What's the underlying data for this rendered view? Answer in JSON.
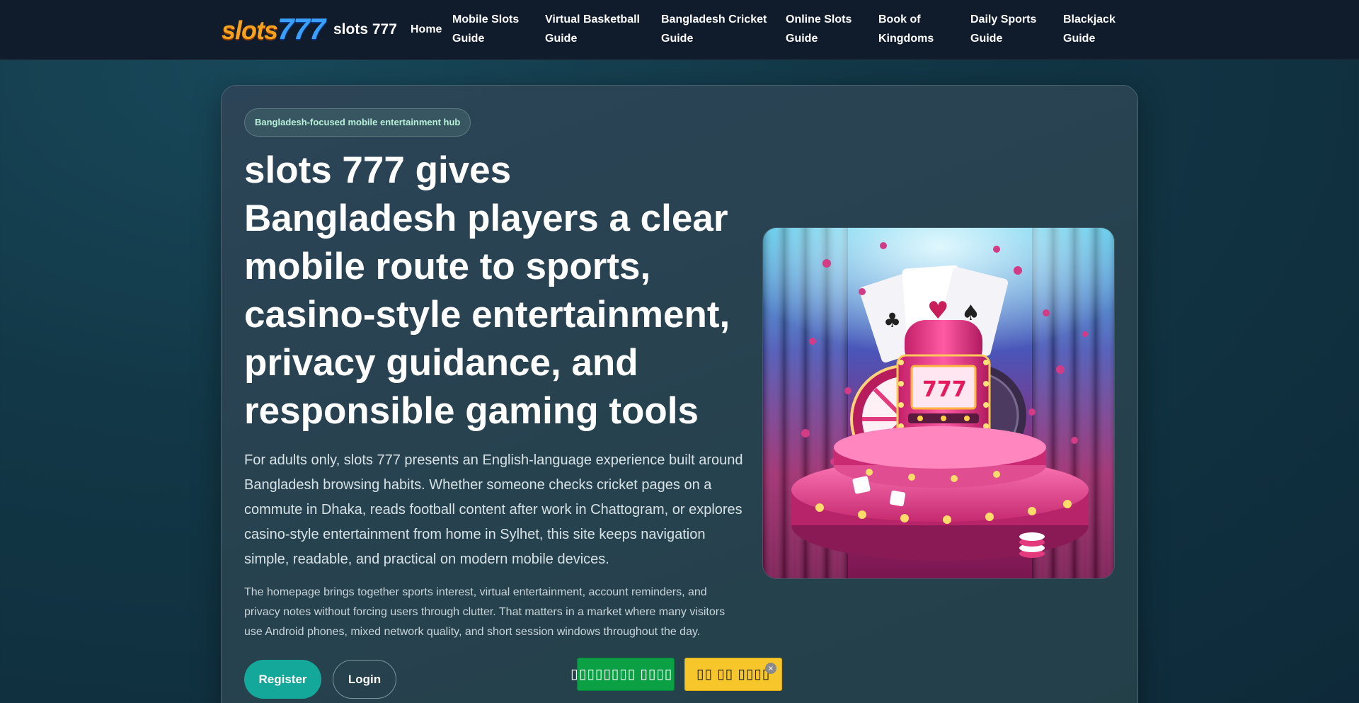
{
  "header": {
    "logo_part1": "slots",
    "logo_part2": "777",
    "brand_name": "slots 777",
    "nav": [
      {
        "line1": "Home",
        "line2": ""
      },
      {
        "line1": "Mobile Slots",
        "line2": "Guide"
      },
      {
        "line1": "Virtual Basketball",
        "line2": "Guide"
      },
      {
        "line1": "Bangladesh Cricket",
        "line2": "Guide"
      },
      {
        "line1": "Online Slots",
        "line2": "Guide"
      },
      {
        "line1": "Book of",
        "line2": "Kingdoms"
      },
      {
        "line1": "Daily Sports",
        "line2": "Guide"
      },
      {
        "line1": "Blackjack",
        "line2": "Guide"
      }
    ]
  },
  "hero": {
    "pill": "Bangladesh-focused mobile entertainment hub",
    "headline_lines": [
      "slots 777 gives",
      "Bangladesh players a clear",
      "mobile route to sports,",
      "casino-style entertainment,",
      "privacy guidance, and",
      "responsible gaming tools"
    ],
    "lead": "For adults only, slots 777 presents an English-language experience built around Bangladesh browsing habits. Whether someone checks cricket pages on a commute in Dhaka, reads football content after work in Chattogram, or explores casino-style entertainment from home in Sylhet, this site keeps navigation simple, readable, and practical on modern mobile devices.",
    "sub": "The homepage brings together sports interest, virtual entertainment, account reminders, and privacy notes without forcing users through clutter. That matters in a market where many visitors use Android phones, mixed network quality, and short session windows throughout the day.",
    "register_label": "Register",
    "login_label": "Login"
  },
  "floating": {
    "prefix": "▯",
    "green_label": "▯▯▯▯▯▯▯ ▯▯▯▯",
    "yellow_label": "▯▯ ▯▯ ▯▯▯▯",
    "close_symbol": "×"
  },
  "colors": {
    "header_bg": "#101c2c",
    "accent_teal": "#14a89a",
    "pill_text": "#b8f0da",
    "green_banner": "#0aa043",
    "yellow_banner": "#f7c62a"
  }
}
